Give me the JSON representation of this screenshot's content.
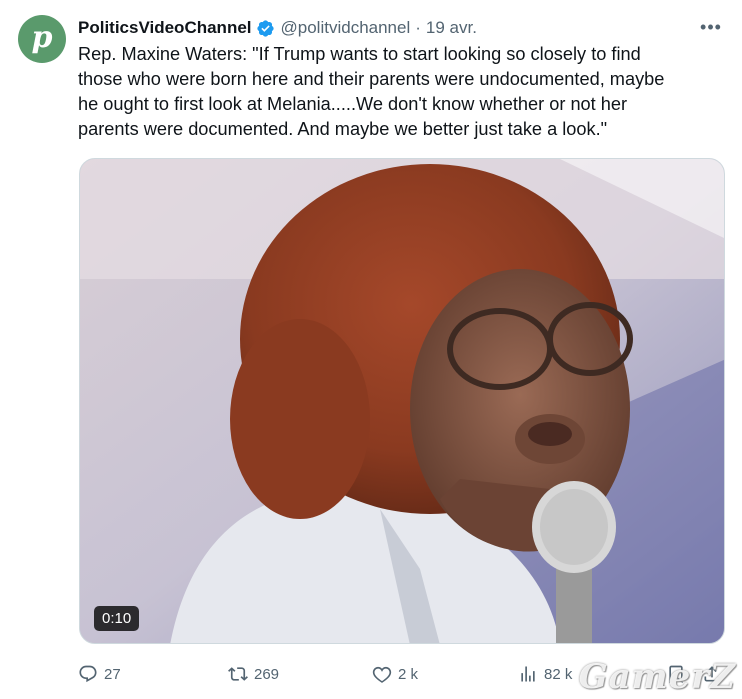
{
  "tweet": {
    "avatar_letter": "p",
    "display_name": "PoliticsVideoChannel",
    "handle": "@politvidchannel",
    "separator": "·",
    "date": "19 avr.",
    "more_label": "•••",
    "text": "Rep. Maxine Waters: \"If Trump wants to start looking so closely to find\nthose who were born here and their parents were undocumented, maybe\nhe ought to first look at Melania.....We don't know whether or not her\nparents were documented. And maybe we better just take a look.\"",
    "video": {
      "duration": "0:10"
    },
    "actions": {
      "replies": "27",
      "retweets": "269",
      "likes": "2 k",
      "views": "82 k"
    }
  },
  "watermark": "GamerZ",
  "colors": {
    "avatar_bg": "#5a9a6c",
    "verified": "#1d9bf0",
    "muted": "#536471"
  }
}
